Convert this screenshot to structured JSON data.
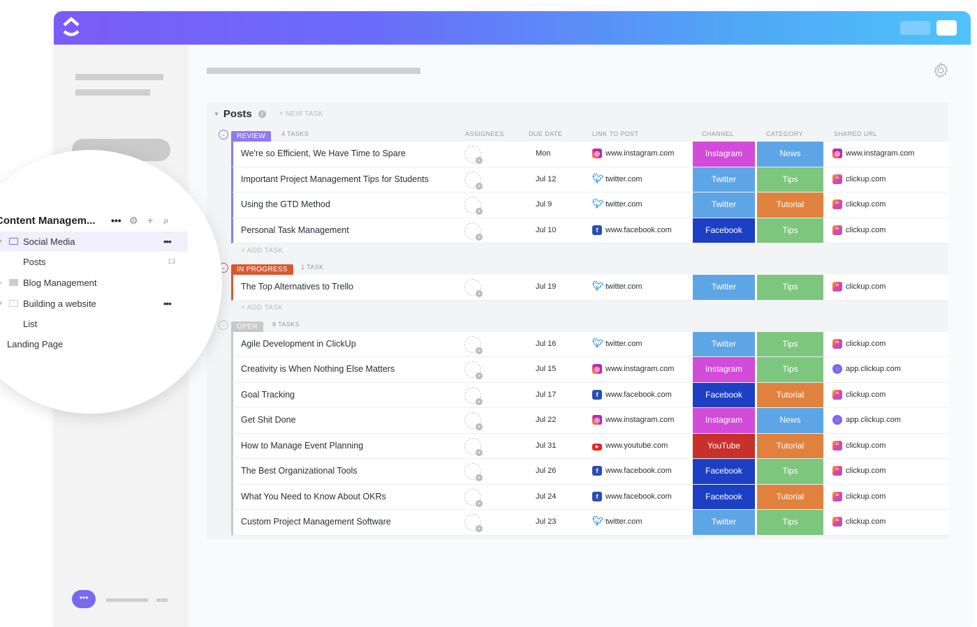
{
  "brand": {
    "accent": "#7b68ee"
  },
  "sidebar": {
    "workspace": "Content Managem...",
    "items": [
      {
        "label": "Social Media",
        "type": "folder",
        "active": true
      },
      {
        "label": "Posts",
        "type": "list",
        "count": "13"
      },
      {
        "label": "Blog Management",
        "type": "folder"
      },
      {
        "label": "Building a website",
        "type": "folder"
      },
      {
        "label": "List",
        "type": "list"
      },
      {
        "label": "Landing Page",
        "type": "list"
      }
    ]
  },
  "list": {
    "title": "Posts",
    "new_task": "+ NEW TASK",
    "add_task": "+ ADD TASK",
    "columns": {
      "assignees": "ASSIGNEES",
      "due": "DUE DATE",
      "link": "LINK TO POST",
      "channel": "CHANNEL",
      "category": "CATEGORY",
      "shared": "SHARED URL"
    }
  },
  "colors": {
    "Instagram": "#d24bd9",
    "Twitter": "#5ea5e6",
    "Facebook": "#1d3fc4",
    "YouTube": "#c8302b",
    "News": "#5ea5e6",
    "Tips": "#7dc67e",
    "Tutorial": "#e0823e"
  },
  "groups": [
    {
      "status": "REVIEW",
      "count": "4 TASKS",
      "color": "#8e7af0",
      "tasks": [
        {
          "name": "We're so Efficient, We Have Time to Spare",
          "due": "Mon",
          "link": "www.instagram.com",
          "link_icon": "instagram-icon",
          "channel": "Instagram",
          "category": "News",
          "url": "www.instagram.com",
          "url_icon": "instagram-icon"
        },
        {
          "name": "Important Project Management Tips for Students",
          "due": "Jul 12",
          "link": "twitter.com",
          "link_icon": "twitter-icon",
          "channel": "Twitter",
          "category": "Tips",
          "url": "clickup.com",
          "url_icon": "clickup-icon"
        },
        {
          "name": "Using the GTD Method",
          "due": "Jul 9",
          "link": "twitter.com",
          "link_icon": "twitter-icon",
          "channel": "Twitter",
          "category": "Tutorial",
          "url": "clickup.com",
          "url_icon": "clickup-icon"
        },
        {
          "name": "Personal Task Management",
          "due": "Jul 10",
          "link": "www.facebook.com",
          "link_icon": "facebook-icon",
          "channel": "Facebook",
          "category": "Tips",
          "url": "clickup.com",
          "url_icon": "clickup-icon"
        }
      ]
    },
    {
      "status": "IN PROGRESS",
      "count": "1 TASK",
      "color": "#d9582f",
      "tasks": [
        {
          "name": "The Top Alternatives to Trello",
          "due": "Jul 19",
          "link": "twitter.com",
          "link_icon": "twitter-icon",
          "channel": "Twitter",
          "category": "Tips",
          "url": "clickup.com",
          "url_icon": "clickup-icon"
        }
      ]
    },
    {
      "status": "OPEN",
      "count": "8 TASKS",
      "color": "#c8c8c8",
      "tasks": [
        {
          "name": "Agile Development in ClickUp",
          "due": "Jul 16",
          "link": "twitter.com",
          "link_icon": "twitter-icon",
          "channel": "Twitter",
          "category": "Tips",
          "url": "clickup.com",
          "url_icon": "clickup-icon"
        },
        {
          "name": "Creativity is When Nothing Else Matters",
          "due": "Jul 15",
          "link": "www.instagram.com",
          "link_icon": "instagram-icon",
          "channel": "Instagram",
          "category": "Tips",
          "url": "app.clickup.com",
          "url_icon": "clickup-app-icon"
        },
        {
          "name": "Goal Tracking",
          "due": "Jul 17",
          "link": "www.facebook.com",
          "link_icon": "facebook-icon",
          "channel": "Facebook",
          "category": "Tutorial",
          "url": "clickup.com",
          "url_icon": "clickup-icon"
        },
        {
          "name": "Get Shit Done",
          "due": "Jul 22",
          "link": "www.instagram.com",
          "link_icon": "instagram-icon",
          "channel": "Instagram",
          "category": "News",
          "url": "app.clickup.com",
          "url_icon": "clickup-app-icon"
        },
        {
          "name": "How to Manage Event Planning",
          "due": "Jul 31",
          "link": "www.youtube.com",
          "link_icon": "youtube-icon",
          "channel": "YouTube",
          "category": "Tutorial",
          "url": "clickup.com",
          "url_icon": "clickup-icon"
        },
        {
          "name": "The Best Organizational Tools",
          "due": "Jul 26",
          "link": "www.facebook.com",
          "link_icon": "facebook-icon",
          "channel": "Facebook",
          "category": "Tips",
          "url": "clickup.com",
          "url_icon": "clickup-icon"
        },
        {
          "name": "What You Need to Know About OKRs",
          "due": "Jul 24",
          "link": "www.facebook.com",
          "link_icon": "facebook-icon",
          "channel": "Facebook",
          "category": "Tutorial",
          "url": "clickup.com",
          "url_icon": "clickup-icon"
        },
        {
          "name": "Custom Project Management Software",
          "due": "Jul 23",
          "link": "twitter.com",
          "link_icon": "twitter-icon",
          "channel": "Twitter",
          "category": "Tips",
          "url": "clickup.com",
          "url_icon": "clickup-icon"
        }
      ]
    }
  ]
}
